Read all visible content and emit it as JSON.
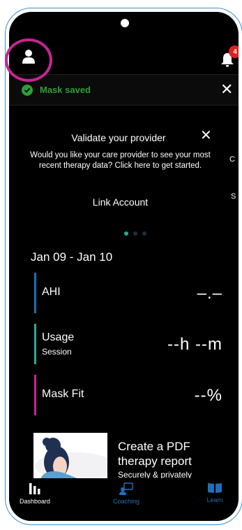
{
  "header": {
    "notification_count": "4"
  },
  "toast": {
    "message": "Mask saved",
    "close_glyph": "✕",
    "color": "#2e9e3a"
  },
  "provider_card": {
    "title": "Validate your provider",
    "body": "Would you like your care provider to see your most recent therapy data?  Click here to get started.",
    "link": "Link Account",
    "close_glyph": "✕",
    "side_peek": [
      "C",
      "S"
    ]
  },
  "carousel": {
    "page_count": 3,
    "active_index": 0
  },
  "dashboard": {
    "date_range": "Jan 09 - Jan 10",
    "metrics": [
      {
        "label": "AHI",
        "sub": "",
        "value": "–.–",
        "color": "#1e6fb8"
      },
      {
        "label": "Usage",
        "sub": "Session",
        "value": "--h --m",
        "color": "#2aa89a"
      },
      {
        "label": "Mask Fit",
        "sub": "",
        "value": "--%",
        "color": "#c5268f"
      }
    ]
  },
  "promo": {
    "title_line1": "Create a PDF",
    "title_line2": "therapy report",
    "subtitle": "Securely & privately"
  },
  "tabs": [
    {
      "label": "Dashboard",
      "icon": "dashboard-icon",
      "active": true
    },
    {
      "label": "Coaching",
      "icon": "coaching-icon",
      "active": false
    },
    {
      "label": "Learn",
      "icon": "book-icon",
      "active": false
    }
  ],
  "colors": {
    "highlight_ring": "#c5268f",
    "badge": "#e02020",
    "tab_inactive": "#1e6fb8"
  }
}
